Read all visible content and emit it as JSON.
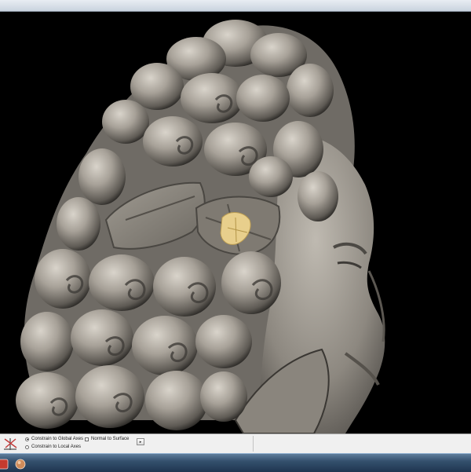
{
  "options_bar": {
    "axis_icon": "transform-axes-icon",
    "constrain_global_label": "Constrain to Global Axes",
    "constrain_global_selected": true,
    "constrain_local_label": "Constrain to Local Axes",
    "constrain_local_selected": false,
    "normal_to_surface_label": "Normal to Surface",
    "normal_to_surface_checked": false,
    "expand_icon": "play-arrow-icon"
  },
  "viewport": {
    "subject": "3d-scanned-sculpture-bust-icon",
    "mesh_color": "#8f8a82",
    "selection_color": "#e8cf8c",
    "background": "#000000"
  },
  "taskbar": {
    "icons": [
      "app-icon-red",
      "app-icon-orb"
    ]
  }
}
